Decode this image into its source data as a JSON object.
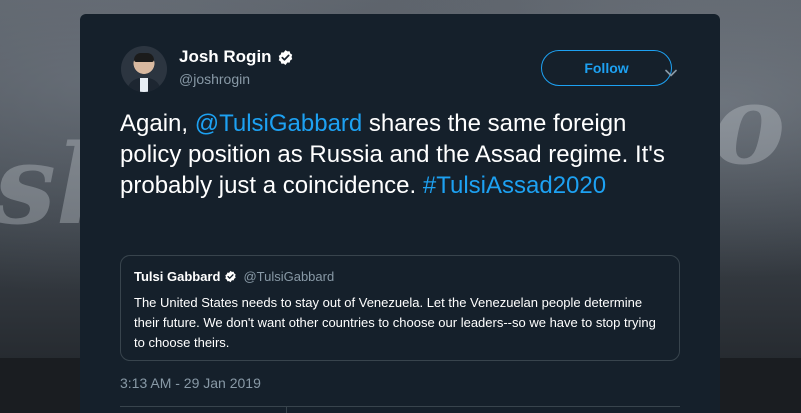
{
  "tweet": {
    "author_name": "Josh Rogin",
    "author_handle": "@joshrogin",
    "follow_label": "Follow",
    "text_parts": {
      "p1": "Again, ",
      "mention": "@TulsiGabbard",
      "p2": " shares the same foreign policy position as Russia and the Assad regime. It's probably just a coincidence. ",
      "hashtag": "#TulsiAssad2020"
    },
    "timestamp": "3:13 AM - 29 Jan 2019"
  },
  "quoted_tweet": {
    "author_name": "Tulsi Gabbard",
    "author_handle": "@TulsiGabbard",
    "text": "The United States needs to stay out of Venezuela. Let the Venezuelan people determine their future. We don't want other countries to choose our leaders--so we have to stop trying to choose theirs."
  },
  "colors": {
    "card_background": "#15202b",
    "accent": "#1da1f2",
    "secondary_text": "#8899a6",
    "border": "#38444d"
  },
  "icons": [
    "verified-icon",
    "chevron-down-icon"
  ]
}
